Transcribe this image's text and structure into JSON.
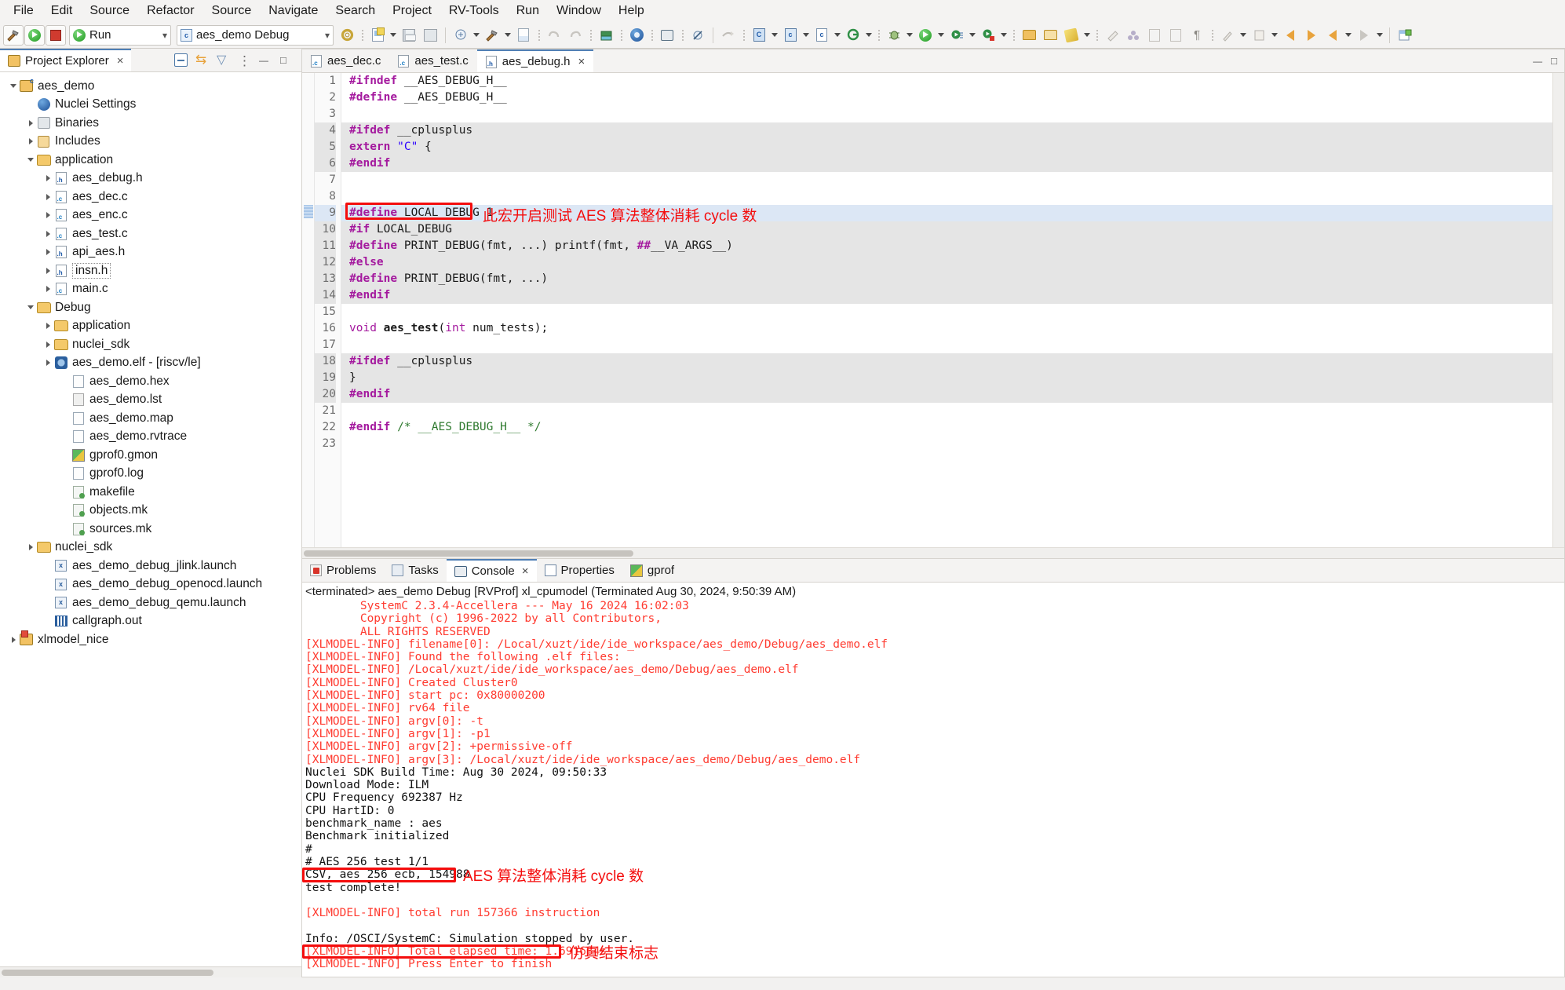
{
  "menu": {
    "items": [
      "File",
      "Edit",
      "Source",
      "Refactor",
      "Source",
      "Navigate",
      "Search",
      "Project",
      "RV-Tools",
      "Run",
      "Window",
      "Help"
    ]
  },
  "toolbar": {
    "run_combo_value": "Run",
    "launch_combo_value": "aes_demo Debug",
    "build_icon": "hammer-icon",
    "run_icon": "run-icon",
    "stop_icon": "stop-icon",
    "settings_icon": "gear-icon"
  },
  "project_explorer": {
    "title": "Project Explorer",
    "close_label": "×",
    "tools": [
      "collapse-all-icon",
      "link-with-editor-icon",
      "filter-icon",
      "view-menu-icon"
    ],
    "tree": [
      {
        "label": "aes_demo",
        "indent": 0,
        "twist": "open",
        "icon": "project-icon"
      },
      {
        "label": "Nuclei Settings",
        "indent": 1,
        "twist": "none",
        "icon": "nuclei-icon"
      },
      {
        "label": "Binaries",
        "indent": 1,
        "twist": "closed",
        "icon": "binaries-icon"
      },
      {
        "label": "Includes",
        "indent": 1,
        "twist": "closed",
        "icon": "includes-icon"
      },
      {
        "label": "application",
        "indent": 1,
        "twist": "open",
        "icon": "folder-icon"
      },
      {
        "label": "aes_debug.h",
        "indent": 2,
        "twist": "closed",
        "icon": "header-file-icon"
      },
      {
        "label": "aes_dec.c",
        "indent": 2,
        "twist": "closed",
        "icon": "c-file-icon"
      },
      {
        "label": "aes_enc.c",
        "indent": 2,
        "twist": "closed",
        "icon": "c-file-icon"
      },
      {
        "label": "aes_test.c",
        "indent": 2,
        "twist": "closed",
        "icon": "c-file-icon"
      },
      {
        "label": "api_aes.h",
        "indent": 2,
        "twist": "closed",
        "icon": "header-file-icon"
      },
      {
        "label": "insn.h",
        "indent": 2,
        "twist": "closed",
        "icon": "header-file-icon",
        "selected": true
      },
      {
        "label": "main.c",
        "indent": 2,
        "twist": "closed",
        "icon": "c-file-icon"
      },
      {
        "label": "Debug",
        "indent": 1,
        "twist": "open",
        "icon": "folder-icon"
      },
      {
        "label": "application",
        "indent": 2,
        "twist": "closed",
        "icon": "folder-icon"
      },
      {
        "label": "nuclei_sdk",
        "indent": 2,
        "twist": "closed",
        "icon": "folder-icon"
      },
      {
        "label": "aes_demo.elf - [riscv/le]",
        "indent": 2,
        "twist": "closed",
        "icon": "elf-icon"
      },
      {
        "label": "aes_demo.hex",
        "indent": 3,
        "twist": "none",
        "icon": "file-icon"
      },
      {
        "label": "aes_demo.lst",
        "indent": 3,
        "twist": "none",
        "icon": "listing-file-icon"
      },
      {
        "label": "aes_demo.map",
        "indent": 3,
        "twist": "none",
        "icon": "file-icon"
      },
      {
        "label": "aes_demo.rvtrace",
        "indent": 3,
        "twist": "none",
        "icon": "file-icon"
      },
      {
        "label": "gprof0.gmon",
        "indent": 3,
        "twist": "none",
        "icon": "gprof-icon"
      },
      {
        "label": "gprof0.log",
        "indent": 3,
        "twist": "none",
        "icon": "file-icon"
      },
      {
        "label": "makefile",
        "indent": 3,
        "twist": "none",
        "icon": "makefile-icon"
      },
      {
        "label": "objects.mk",
        "indent": 3,
        "twist": "none",
        "icon": "makefile-icon"
      },
      {
        "label": "sources.mk",
        "indent": 3,
        "twist": "none",
        "icon": "makefile-icon"
      },
      {
        "label": "nuclei_sdk",
        "indent": 1,
        "twist": "closed",
        "icon": "folder-icon"
      },
      {
        "label": "aes_demo_debug_jlink.launch",
        "indent": 2,
        "twist": "none",
        "icon": "launch-icon"
      },
      {
        "label": "aes_demo_debug_openocd.launch",
        "indent": 2,
        "twist": "none",
        "icon": "launch-icon"
      },
      {
        "label": "aes_demo_debug_qemu.launch",
        "indent": 2,
        "twist": "none",
        "icon": "launch-icon"
      },
      {
        "label": "callgraph.out",
        "indent": 2,
        "twist": "none",
        "icon": "callgraph-icon"
      },
      {
        "label": "xlmodel_nice",
        "indent": 0,
        "twist": "closed",
        "icon": "project-icon-red"
      }
    ]
  },
  "editor": {
    "tabs": [
      {
        "label": "aes_dec.c",
        "icon": "c-file-icon",
        "active": false,
        "closable": false
      },
      {
        "label": "aes_test.c",
        "icon": "c-file-icon",
        "active": false,
        "closable": false
      },
      {
        "label": "aes_debug.h",
        "icon": "header-file-icon",
        "active": true,
        "closable": true
      }
    ],
    "close_label": "×",
    "minimize_label": "—",
    "maximize_label": "□",
    "lines": [
      {
        "n": 1,
        "shade": false,
        "hl": false,
        "html": "<span class='kw'>#ifndef</span> __AES_DEBUG_H__"
      },
      {
        "n": 2,
        "shade": false,
        "hl": false,
        "html": "<span class='kw'>#define</span> __AES_DEBUG_H__"
      },
      {
        "n": 3,
        "shade": false,
        "hl": false,
        "html": ""
      },
      {
        "n": 4,
        "shade": true,
        "hl": false,
        "html": "<span class='kw'>#ifdef</span> __cplusplus"
      },
      {
        "n": 5,
        "shade": true,
        "hl": false,
        "html": "<span class='kw'>extern</span> <span class='str'>\"C\"</span> {"
      },
      {
        "n": 6,
        "shade": true,
        "hl": false,
        "html": "<span class='kw'>#endif</span>"
      },
      {
        "n": 7,
        "shade": false,
        "hl": false,
        "html": ""
      },
      {
        "n": 8,
        "shade": false,
        "hl": false,
        "html": ""
      },
      {
        "n": 9,
        "shade": false,
        "hl": true,
        "html": "<span class='kw'>#define</span> LOCAL_DEBUG 1"
      },
      {
        "n": 10,
        "shade": true,
        "hl": false,
        "html": "<span class='kw'>#if</span> LOCAL_DEBUG"
      },
      {
        "n": 11,
        "shade": true,
        "hl": false,
        "html": "<span class='kw'>#define</span> PRINT_DEBUG(fmt, ...) printf(fmt, <span class='kw'>##</span>__VA_ARGS__)"
      },
      {
        "n": 12,
        "shade": true,
        "hl": false,
        "html": "<span class='kw'>#else</span>"
      },
      {
        "n": 13,
        "shade": true,
        "hl": false,
        "html": "<span class='kw'>#define</span> PRINT_DEBUG(fmt, ...)"
      },
      {
        "n": 14,
        "shade": true,
        "hl": false,
        "html": "<span class='kw'>#endif</span>"
      },
      {
        "n": 15,
        "shade": false,
        "hl": false,
        "html": ""
      },
      {
        "n": 16,
        "shade": false,
        "hl": false,
        "html": "<span class='ty'>void</span> <span class='fn'>aes_test</span>(<span class='ty'>int</span> num_tests);"
      },
      {
        "n": 17,
        "shade": false,
        "hl": false,
        "html": ""
      },
      {
        "n": 18,
        "shade": true,
        "hl": false,
        "html": "<span class='kw'>#ifdef</span> __cplusplus"
      },
      {
        "n": 19,
        "shade": true,
        "hl": false,
        "html": "}"
      },
      {
        "n": 20,
        "shade": true,
        "hl": false,
        "html": "<span class='kw'>#endif</span>"
      },
      {
        "n": 21,
        "shade": false,
        "hl": false,
        "html": ""
      },
      {
        "n": 22,
        "shade": false,
        "hl": false,
        "html": "<span class='kw'>#endif</span> <span class='cmt'>/* __AES_DEBUG_H__ */</span>"
      },
      {
        "n": 23,
        "shade": false,
        "hl": false,
        "html": ""
      }
    ]
  },
  "annotations": {
    "code_note": "此宏开启测试 AES 算法整体消耗 cycle 数",
    "console_note_csv": "AES 算法整体消耗 cycle 数",
    "console_note_elapsed": "仿真结束标志",
    "color": "#f40d0d"
  },
  "bottom_panel": {
    "tabs": [
      {
        "label": "Problems",
        "icon": "problems-icon",
        "active": false,
        "closable": false
      },
      {
        "label": "Tasks",
        "icon": "tasks-icon",
        "active": false,
        "closable": false
      },
      {
        "label": "Console",
        "icon": "console-icon",
        "active": true,
        "closable": true
      },
      {
        "label": "Properties",
        "icon": "properties-icon",
        "active": false,
        "closable": false
      },
      {
        "label": "gprof",
        "icon": "gprof-icon",
        "active": false,
        "closable": false
      }
    ],
    "close_label": "×",
    "status": "<terminated> aes_demo Debug [RVProf] xl_cpumodel (Terminated Aug 30, 2024, 9:50:39 AM)",
    "console_lines": [
      {
        "t": "r",
        "text": "        SystemC 2.3.4-Accellera --- May 16 2024 16:02:03"
      },
      {
        "t": "r",
        "text": "        Copyright (c) 1996-2022 by all Contributors,"
      },
      {
        "t": "r",
        "text": "        ALL RIGHTS RESERVED"
      },
      {
        "t": "r",
        "text": "[XLMODEL-INFO] filename[0]: /Local/xuzt/ide/ide_workspace/aes_demo/Debug/aes_demo.elf"
      },
      {
        "t": "r",
        "text": "[XLMODEL-INFO] Found the following .elf files:"
      },
      {
        "t": "r",
        "text": "[XLMODEL-INFO] /Local/xuzt/ide/ide_workspace/aes_demo/Debug/aes_demo.elf"
      },
      {
        "t": "r",
        "text": "[XLMODEL-INFO] Created Cluster0"
      },
      {
        "t": "r",
        "text": "[XLMODEL-INFO] start pc: 0x80000200"
      },
      {
        "t": "r",
        "text": "[XLMODEL-INFO] rv64 file"
      },
      {
        "t": "r",
        "text": "[XLMODEL-INFO] argv[0]: -t"
      },
      {
        "t": "r",
        "text": "[XLMODEL-INFO] argv[1]: -p1"
      },
      {
        "t": "r",
        "text": "[XLMODEL-INFO] argv[2]: +permissive-off"
      },
      {
        "t": "r",
        "text": "[XLMODEL-INFO] argv[3]: /Local/xuzt/ide/ide_workspace/aes_demo/Debug/aes_demo.elf"
      },
      {
        "t": "k",
        "text": "Nuclei SDK Build Time: Aug 30 2024, 09:50:33"
      },
      {
        "t": "k",
        "text": "Download Mode: ILM"
      },
      {
        "t": "k",
        "text": "CPU Frequency 692387 Hz"
      },
      {
        "t": "k",
        "text": "CPU HartID: 0"
      },
      {
        "t": "k",
        "text": "benchmark_name : aes"
      },
      {
        "t": "k",
        "text": "Benchmark initialized"
      },
      {
        "t": "k",
        "text": "#"
      },
      {
        "t": "k",
        "text": "# AES 256 test 1/1"
      },
      {
        "t": "k",
        "text": "CSV, aes_256_ecb, 154988"
      },
      {
        "t": "k",
        "text": "test complete!"
      },
      {
        "t": "r",
        "text": ""
      },
      {
        "t": "r",
        "text": "[XLMODEL-INFO] total run 157366 instruction"
      },
      {
        "t": "r",
        "text": ""
      },
      {
        "t": "k",
        "text": "Info: /OSCI/SystemC: Simulation stopped by user."
      },
      {
        "t": "r",
        "text": "[XLMODEL-INFO] Total elapsed time: 1.691684s"
      },
      {
        "t": "r",
        "text": "[XLMODEL-INFO] Press Enter to finish"
      }
    ]
  }
}
